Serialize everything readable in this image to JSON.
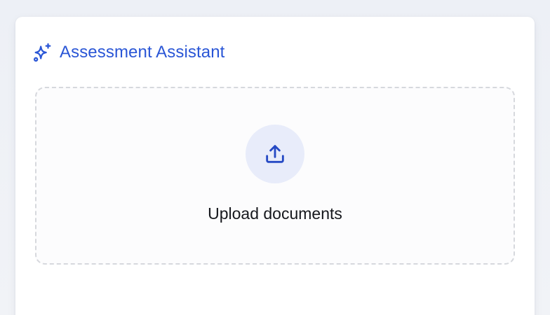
{
  "card": {
    "title": "Assessment Assistant",
    "icon": "sparkle-icon"
  },
  "dropzone": {
    "label": "Upload documents",
    "icon": "upload-icon"
  },
  "colors": {
    "accent": "#2a56d6",
    "icon_circle_bg": "#e8ecfa",
    "dropzone_border": "#d6d8dd"
  }
}
